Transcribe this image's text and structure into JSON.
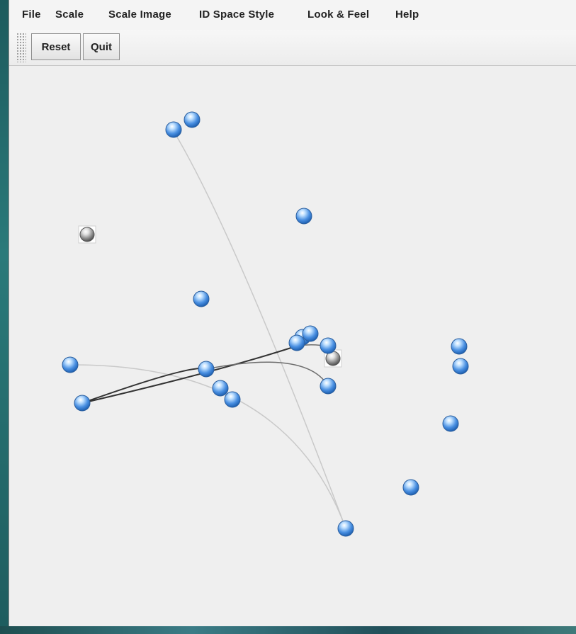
{
  "menu": {
    "items": [
      "File",
      "Scale",
      "Scale Image",
      "ID Space Style",
      "Look & Feel",
      "Help"
    ]
  },
  "toolbar": {
    "reset_label": "Reset",
    "quit_label": "Quit"
  },
  "graph": {
    "node_colors": {
      "blue": "#4a90e2",
      "gray": "#8a8a8a"
    },
    "edge_colors": {
      "light": "#c9c9c9",
      "dark": "#333333",
      "medium": "#6e6e6e"
    }
  }
}
